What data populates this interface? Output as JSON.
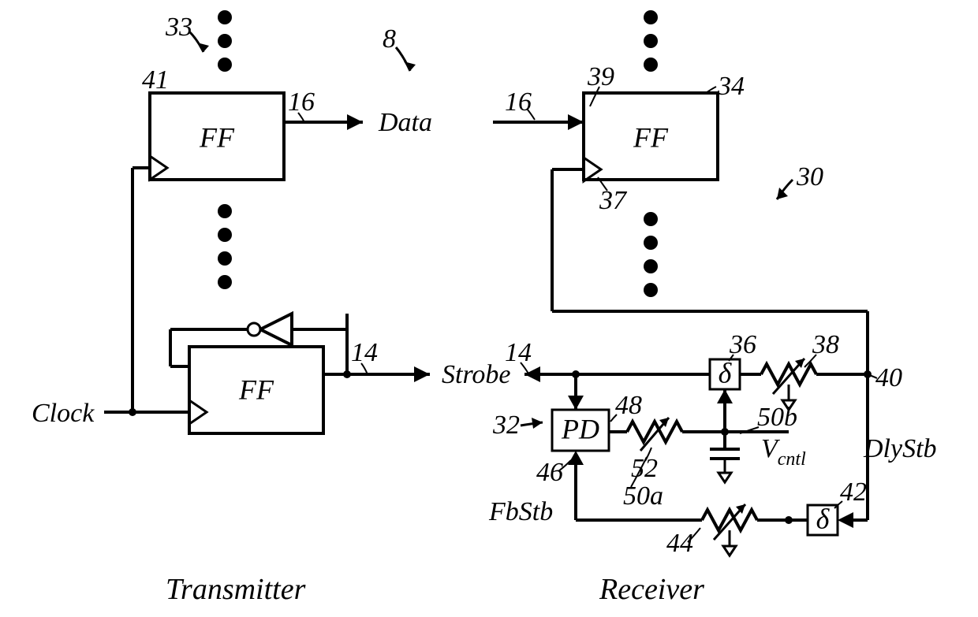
{
  "transmitter": {
    "label": "Transmitter",
    "clock_label": "Clock",
    "ff1_label": "FF",
    "ff2_label": "FF",
    "ref_33": "33",
    "ref_41": "41",
    "ref_16_out": "16",
    "ref_14_out": "14"
  },
  "data_label": "Data",
  "strobe_label": "Strobe",
  "ref_8": "8",
  "receiver": {
    "label": "Receiver",
    "ff_label": "FF",
    "pd_label": "PD",
    "delta1": "δ",
    "delta2": "δ",
    "vcntl_label_v": "V",
    "vcntl_label_sub": "cntl",
    "dlystb_label": "DlyStb",
    "fbstb_label": "FbStb",
    "ref_16_in": "16",
    "ref_39": "39",
    "ref_34": "34",
    "ref_30": "30",
    "ref_37": "37",
    "ref_14_in": "14",
    "ref_36": "36",
    "ref_38": "38",
    "ref_40": "40",
    "ref_32": "32",
    "ref_48": "48",
    "ref_50b": "50b",
    "ref_50a": "50a",
    "ref_52": "52",
    "ref_46": "46",
    "ref_44": "44",
    "ref_42": "42"
  }
}
